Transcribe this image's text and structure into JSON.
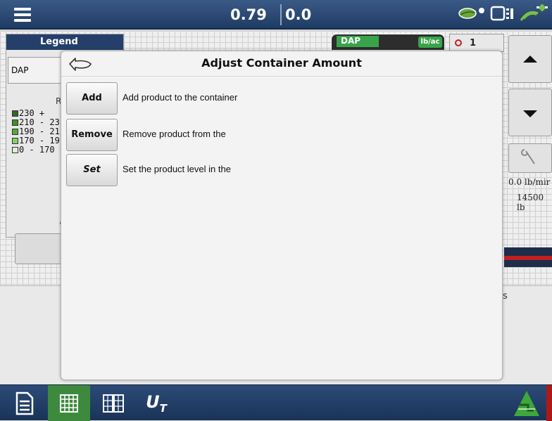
{
  "topbar": {
    "readout_a": "0.79",
    "readout_b": "0.0",
    "icons": [
      "menu-icon",
      "leaf-icon",
      "screen-icon",
      "gps-icon"
    ]
  },
  "legend": {
    "header": "Legend",
    "product": "DAP",
    "rate_label": "Ra",
    "ranges": [
      {
        "label": "230 +",
        "color": "#2e6b1f"
      },
      {
        "label": "210 - 23",
        "color": "#3f8f2a"
      },
      {
        "label": "190 - 21",
        "color": "#54ab39"
      },
      {
        "label": "170 - 19",
        "color": "#86cf6a"
      },
      {
        "label": "0 - 170",
        "color": "#d7f2cd"
      }
    ]
  },
  "product_tab": {
    "name": "DAP",
    "unit": "lb/ac",
    "alarm_count": "1"
  },
  "right_panel": {
    "rate_a": "0.0 lb/mir",
    "rate_b": "14500 lb"
  },
  "lower": {
    "text": "s"
  },
  "modal": {
    "title": "Adjust Container Amount",
    "options": [
      {
        "button": "Add",
        "description": "Add product to the container"
      },
      {
        "button": "Remove",
        "description": "Remove product from the"
      },
      {
        "button": "Set",
        "description": "Set the product level in the"
      }
    ]
  },
  "bottombar": {
    "ut_label": "U",
    "ut_sub": "T"
  },
  "colors": {
    "accent_green": "#3d8a3e",
    "topbar_blue": "#1f3b63",
    "alert_red": "#c02020"
  }
}
